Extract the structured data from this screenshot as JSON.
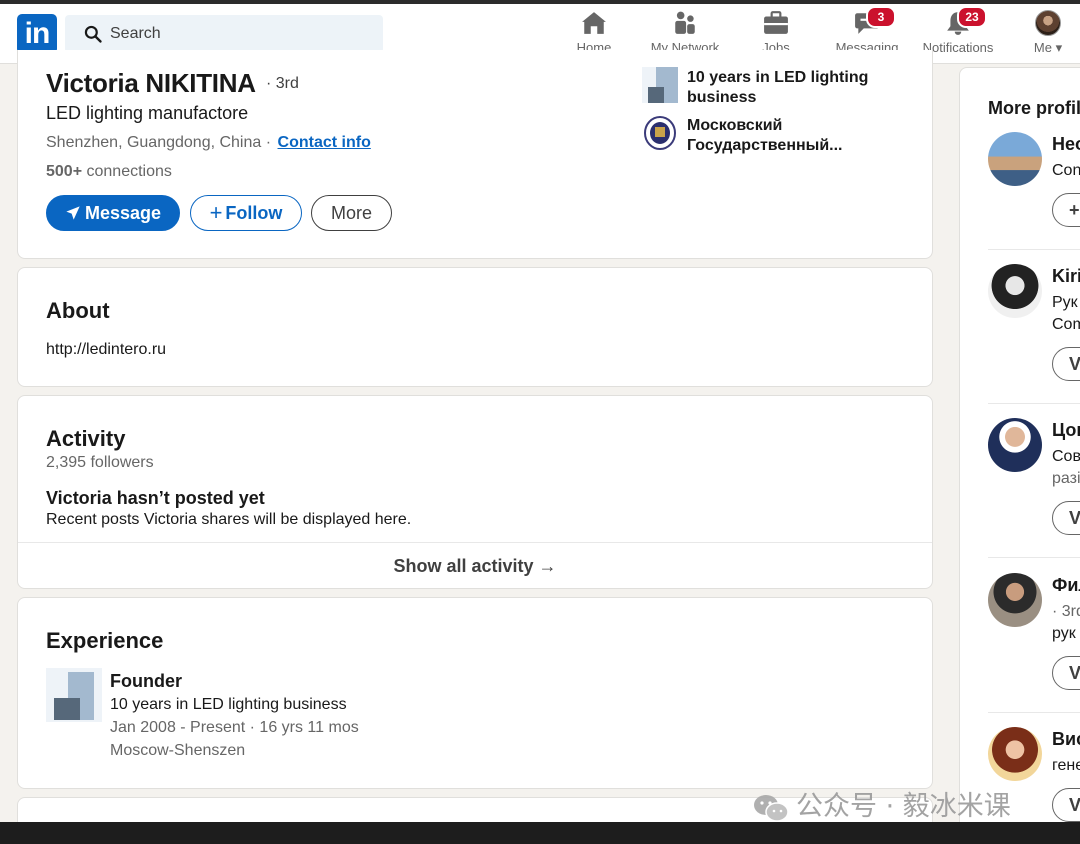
{
  "header": {
    "logo_text": "in",
    "search_placeholder": "Search",
    "nav": [
      {
        "label": "Home",
        "icon": "home-icon"
      },
      {
        "label": "My Network",
        "icon": "network-icon"
      },
      {
        "label": "Jobs",
        "icon": "briefcase-icon"
      },
      {
        "label": "Messaging",
        "icon": "messaging-icon",
        "badge": "3"
      },
      {
        "label": "Notifications",
        "icon": "bell-icon",
        "badge": "23"
      },
      {
        "label": "Me",
        "icon": "avatar"
      }
    ]
  },
  "profile": {
    "name": "Victoria NIKITINA",
    "degree": "· 3rd",
    "headline": "LED lighting manufactore",
    "location": "Shenzhen, Guangdong, China ·",
    "contact_info": "Contact info",
    "connections_count": "500+",
    "connections_label": "connections",
    "buttons": {
      "message": "Message",
      "follow": "Follow",
      "more": "More"
    },
    "current_company": "10 years in LED lighting business",
    "education": "Московский Государственный..."
  },
  "about": {
    "title": "About",
    "text": "http://ledintero.ru"
  },
  "activity": {
    "title": "Activity",
    "followers": "2,395 followers",
    "empty_title": "Victoria hasn’t posted yet",
    "empty_text": "Recent posts Victoria shares will be displayed here.",
    "show_all": "Show all activity →"
  },
  "experience": {
    "title": "Experience",
    "items": [
      {
        "title": "Founder",
        "company": "10 years in LED lighting business",
        "dates": "Jan 2008 - Present · 16 yrs 11 mos",
        "location": "Moscow-Shenszen"
      }
    ]
  },
  "rail": {
    "title": "More profiles",
    "people": [
      {
        "name": "Heo",
        "lines": [
          "Con"
        ],
        "button": "+"
      },
      {
        "name": "Kiri",
        "lines": [
          "Рук",
          "Com"
        ],
        "button": "V"
      },
      {
        "name": "Цог",
        "lines": [
          "Сов",
          "разі"
        ],
        "button": "V"
      },
      {
        "name": "Фил",
        "lines": [
          "· 3rd",
          "рук"
        ],
        "button": "V"
      },
      {
        "name": "Вис",
        "lines": [
          "гене"
        ],
        "button": "V"
      }
    ]
  },
  "watermark": "公众号 · 毅冰米课"
}
